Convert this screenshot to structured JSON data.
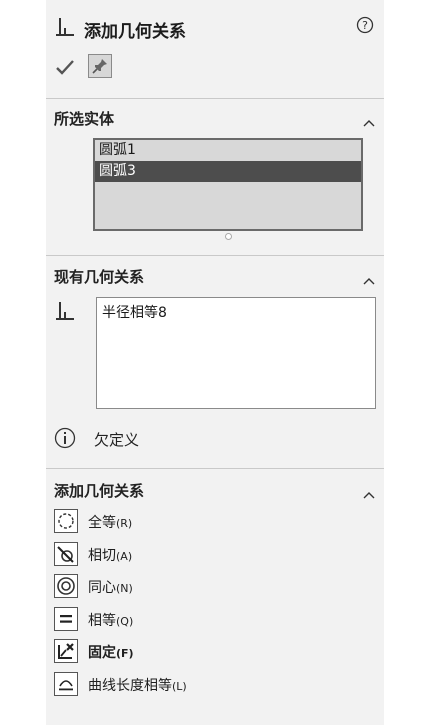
{
  "header": {
    "title": "添加几何关系"
  },
  "selected": {
    "title": "所选实体",
    "items": [
      {
        "label": "圆弧1",
        "selected": false
      },
      {
        "label": "圆弧3",
        "selected": true
      }
    ]
  },
  "existing": {
    "title": "现有几何关系",
    "items": [
      "半径相等8"
    ],
    "status": "欠定义"
  },
  "add": {
    "title": "添加几何关系",
    "items": [
      {
        "name": "全等",
        "key": "(R)",
        "icon": "coradial-icon",
        "bold": false
      },
      {
        "name": "相切",
        "key": "(A)",
        "icon": "tangent-icon",
        "bold": false
      },
      {
        "name": "同心",
        "key": "(N)",
        "icon": "concentric-icon",
        "bold": false
      },
      {
        "name": "相等",
        "key": "(Q)",
        "icon": "equal-icon",
        "bold": false
      },
      {
        "name": "固定",
        "key": "(F)",
        "icon": "fix-icon",
        "bold": true
      },
      {
        "name": "曲线长度相等",
        "key": "(L)",
        "icon": "equal-curve-length-icon",
        "bold": false
      }
    ]
  }
}
